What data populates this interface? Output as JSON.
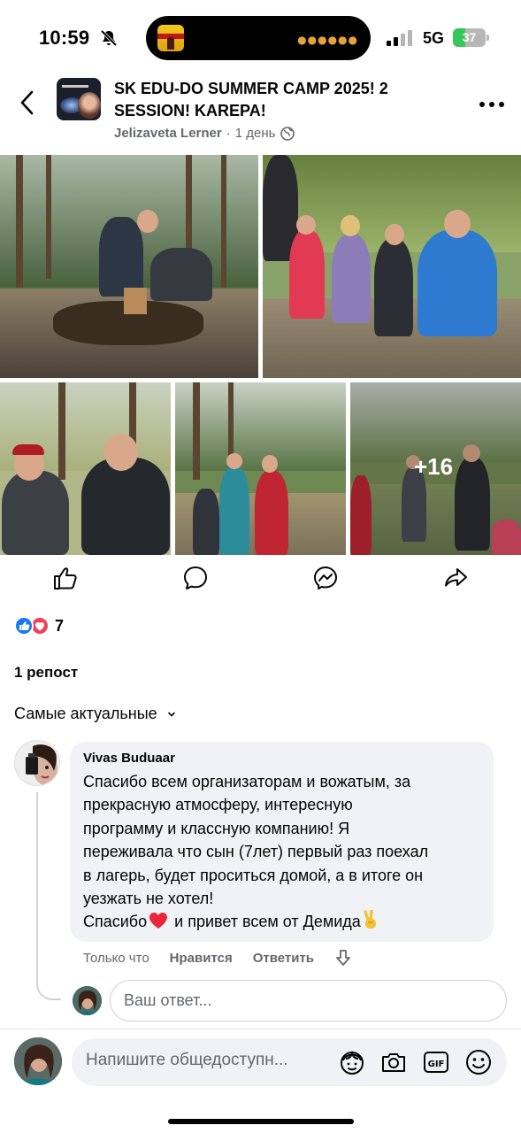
{
  "status_bar": {
    "time": "10:59",
    "network": "5G",
    "battery_level": "37",
    "battery_fraction": 0.37
  },
  "header": {
    "title": "SK EDU-DO SUMMER CAMP 2025! 2 SESSION! KAREPA!",
    "author": "Jelizaveta Lerner",
    "separator": "·",
    "time_ago": "1 день",
    "back_icon": "chevron-left-icon",
    "more_icon": "more-horizontal-icon"
  },
  "photos": {
    "more_count": "+16"
  },
  "actions": {
    "icons": [
      "like-icon",
      "comment-icon",
      "messenger-icon",
      "share-icon"
    ]
  },
  "reactions": {
    "count": "7",
    "types": [
      "like",
      "love"
    ]
  },
  "reposts": "1 репост",
  "sort_label": "Самые актуальные",
  "comment": {
    "author": "Vivas Buduaar",
    "lines": [
      "Спасибо всем организаторам и вожатым, за",
      "прекрасную атмосферу, интересную",
      "программу и классную компанию! Я",
      "переживала что сын (7лет) первый раз поехал",
      "в лагерь, будет проситься домой, а в итоге он",
      "уезжать не хотел!"
    ],
    "last_line_start": "Спасибо",
    "last_line_end": " и привет всем от Демида",
    "time": "Только что",
    "like_label": "Нравится",
    "reply_label": "Ответить"
  },
  "reply_box": {
    "placeholder": "Ваш ответ..."
  },
  "composer": {
    "placeholder": "Напишите общедоступн...",
    "icons": [
      "avatar-sticker-icon",
      "camera-icon",
      "gif-icon",
      "emoji-icon"
    ]
  },
  "colors": {
    "facebook_blue": "#1877f2",
    "love_red": "#f33e58",
    "secondary_text": "#65676b",
    "bubble_bg": "#f0f2f5"
  }
}
